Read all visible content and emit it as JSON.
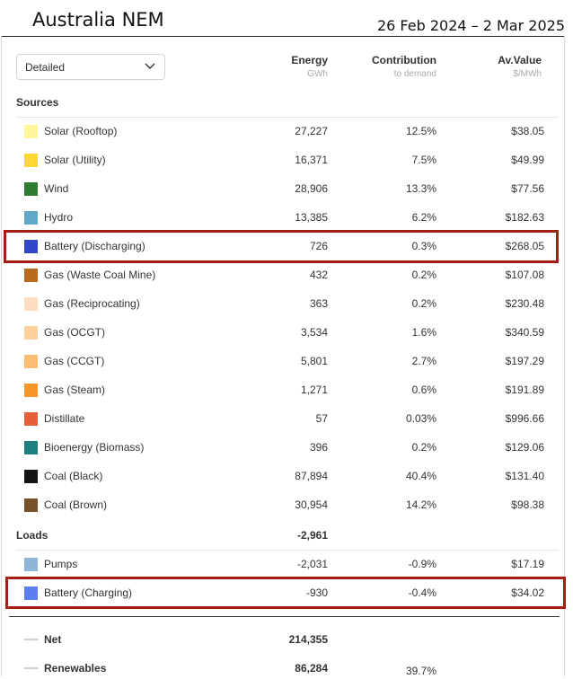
{
  "header": {
    "title": "Australia NEM",
    "date_range": "26 Feb 2024 – 2 Mar 2025"
  },
  "view_select": {
    "selected": "Detailed"
  },
  "columns": {
    "energy": {
      "label": "Energy",
      "unit": "GWh"
    },
    "contribution": {
      "label": "Contribution",
      "unit": "to demand"
    },
    "value": {
      "label": "Av.Value",
      "unit": "$/MWh"
    }
  },
  "sources": {
    "label": "Sources",
    "rows": [
      {
        "name": "Solar (Rooftop)",
        "color": "#fff59d",
        "energy": "27,227",
        "contribution": "12.5%",
        "value": "$38.05"
      },
      {
        "name": "Solar (Utility)",
        "color": "#fdd835",
        "energy": "16,371",
        "contribution": "7.5%",
        "value": "$49.99"
      },
      {
        "name": "Wind",
        "color": "#2e7d32",
        "energy": "28,906",
        "contribution": "13.3%",
        "value": "$77.56"
      },
      {
        "name": "Hydro",
        "color": "#5fa8c8",
        "energy": "13,385",
        "contribution": "6.2%",
        "value": "$182.63"
      },
      {
        "name": "Battery (Discharging)",
        "color": "#3246c8",
        "energy": "726",
        "contribution": "0.3%",
        "value": "$268.05"
      },
      {
        "name": "Gas (Waste Coal Mine)",
        "color": "#b86b1e",
        "energy": "432",
        "contribution": "0.2%",
        "value": "$107.08"
      },
      {
        "name": "Gas (Reciprocating)",
        "color": "#fddcc0",
        "energy": "363",
        "contribution": "0.2%",
        "value": "$230.48"
      },
      {
        "name": "Gas (OCGT)",
        "color": "#fdd09e",
        "energy": "3,534",
        "contribution": "1.6%",
        "value": "$340.59"
      },
      {
        "name": "Gas (CCGT)",
        "color": "#fdbe73",
        "energy": "5,801",
        "contribution": "2.7%",
        "value": "$197.29"
      },
      {
        "name": "Gas (Steam)",
        "color": "#f8962a",
        "energy": "1,271",
        "contribution": "0.6%",
        "value": "$191.89"
      },
      {
        "name": "Distillate",
        "color": "#e5603a",
        "energy": "57",
        "contribution": "0.03%",
        "value": "$996.66"
      },
      {
        "name": "Bioenergy (Biomass)",
        "color": "#1e7f7f",
        "energy": "396",
        "contribution": "0.2%",
        "value": "$129.06"
      },
      {
        "name": "Coal (Black)",
        "color": "#141414",
        "energy": "87,894",
        "contribution": "40.4%",
        "value": "$131.40"
      },
      {
        "name": "Coal (Brown)",
        "color": "#77502c",
        "energy": "30,954",
        "contribution": "14.2%",
        "value": "$98.38"
      }
    ]
  },
  "loads": {
    "label": "Loads",
    "total": "-2,961",
    "rows": [
      {
        "name": "Pumps",
        "color": "#8fb6d6",
        "energy": "-2,031",
        "contribution": "-0.9%",
        "value": "$17.19"
      },
      {
        "name": "Battery (Charging)",
        "color": "#5b7ef5",
        "energy": "-930",
        "contribution": "-0.4%",
        "value": "$34.02"
      }
    ]
  },
  "summary": {
    "net": {
      "label": "Net",
      "energy": "214,355"
    },
    "renewables": {
      "label": "Renewables",
      "energy": "86,284",
      "contribution": "39.7%"
    }
  }
}
